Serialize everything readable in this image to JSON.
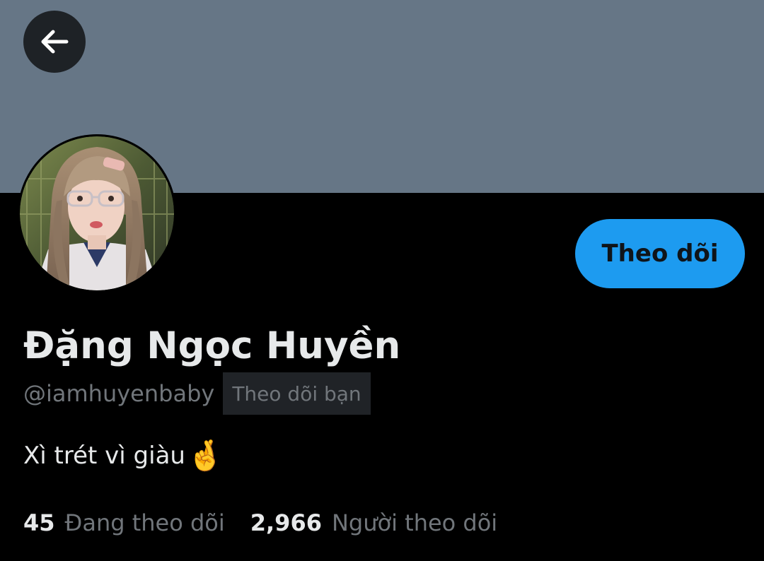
{
  "profile": {
    "display_name": "Đặng Ngọc Huyền",
    "handle": "@iamhuyenbaby",
    "follows_you_badge": "Theo dõi bạn",
    "bio": "Xì trét vì giàu",
    "bio_emoji": "🤞",
    "avatar": "profile-photo"
  },
  "actions": {
    "back_icon": "arrow-left-icon",
    "follow_label": "Theo dõi"
  },
  "stats": {
    "following_count": "45",
    "following_label": "Đang theo dõi",
    "followers_count": "2,966",
    "followers_label": "Người theo dõi"
  },
  "colors": {
    "banner": "#667686",
    "background": "#000000",
    "accent": "#1d9bf0",
    "primary_text": "#e7e9ea",
    "secondary_text": "#71767b",
    "badge_background": "#202327"
  }
}
